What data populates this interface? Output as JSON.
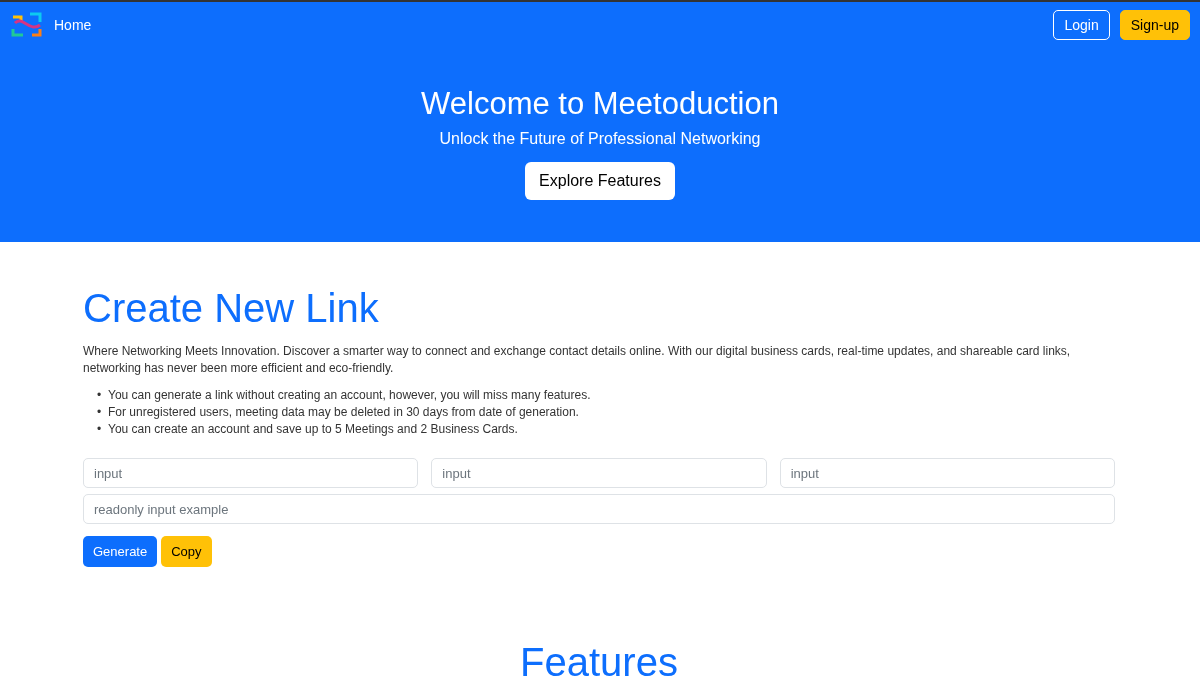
{
  "navbar": {
    "home": "Home",
    "login": "Login",
    "signup": "Sign-up"
  },
  "hero": {
    "title": "Welcome to Meetoduction",
    "subtitle": "Unlock the Future of Professional Networking",
    "button": "Explore Features"
  },
  "create": {
    "title": "Create New Link",
    "intro": "Where Networking Meets Innovation. Discover a smarter way to connect and exchange contact details online. With our digital business cards, real-time updates, and shareable card links, networking has never been more efficient and eco-friendly.",
    "bullet": "•",
    "notes": [
      "You can generate a link without creating an account, however, you will miss many features.",
      "For unregistered users, meeting data may be deleted in 30 days from date of generation.",
      "You can create an account and save up to 5 Meetings and 2 Business Cards."
    ],
    "inputs": [
      {
        "placeholder": "input"
      },
      {
        "placeholder": "input"
      },
      {
        "placeholder": "input"
      }
    ],
    "readonly": {
      "placeholder": "readonly input example"
    },
    "buttons": [
      "Generate",
      "Copy"
    ]
  },
  "features": {
    "title": "Features"
  }
}
